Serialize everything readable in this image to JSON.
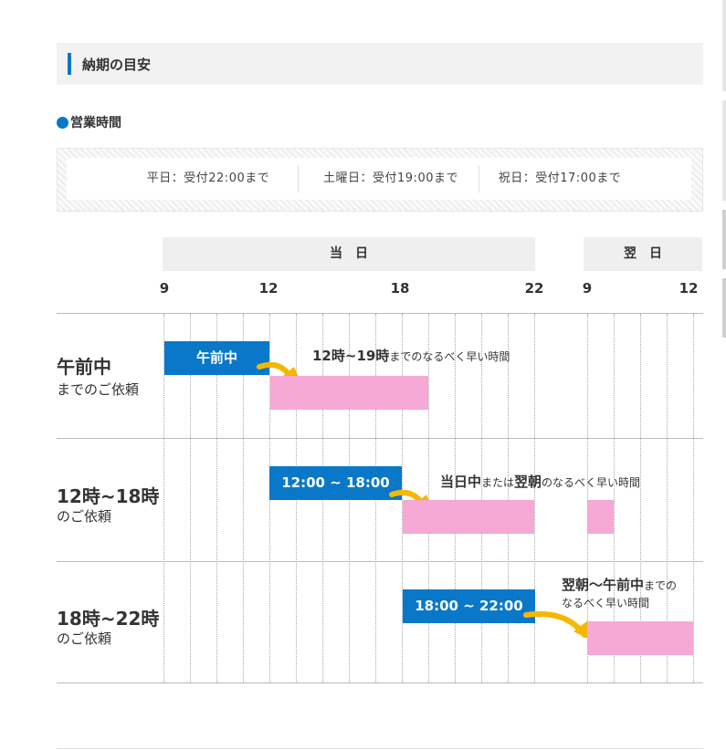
{
  "section": {
    "title": "納期の目安"
  },
  "business_hours": {
    "title": "営業時間",
    "items": [
      "平日：受付22:00まで",
      "土曜日：受付19:00まで",
      "祝日：受付17:00まで"
    ]
  },
  "timeline": {
    "bands": [
      "当　日",
      "翌　日"
    ],
    "ticks": [
      "9",
      "12",
      "18",
      "22",
      "9",
      "12"
    ]
  },
  "rows": [
    {
      "title": "午前中",
      "subtitle": "までのご依頼",
      "box_label": "午前中",
      "note": {
        "bold1": "12時~19時",
        "text1": "までのなるべく早い時間"
      }
    },
    {
      "title": "12時~18時",
      "subtitle": "のご依頼",
      "box_label": "12:00 ~ 18:00",
      "note": {
        "bold1": "当日中",
        "text1": "または",
        "bold2": "翌朝",
        "text2": "のなるべく早い時間"
      }
    },
    {
      "title": "18時~22時",
      "subtitle": "のご依頼",
      "box_label": "18:00 ~ 22:00",
      "note": {
        "bold1": "翌朝～午前中",
        "text1": "までの",
        "line2": "なるべく早い時間"
      }
    }
  ],
  "colors": {
    "accent_blue": "#0a78c8",
    "pink": "#f5a9d4",
    "arrow_yellow": "#f5b800",
    "band_gray": "#efefef"
  }
}
